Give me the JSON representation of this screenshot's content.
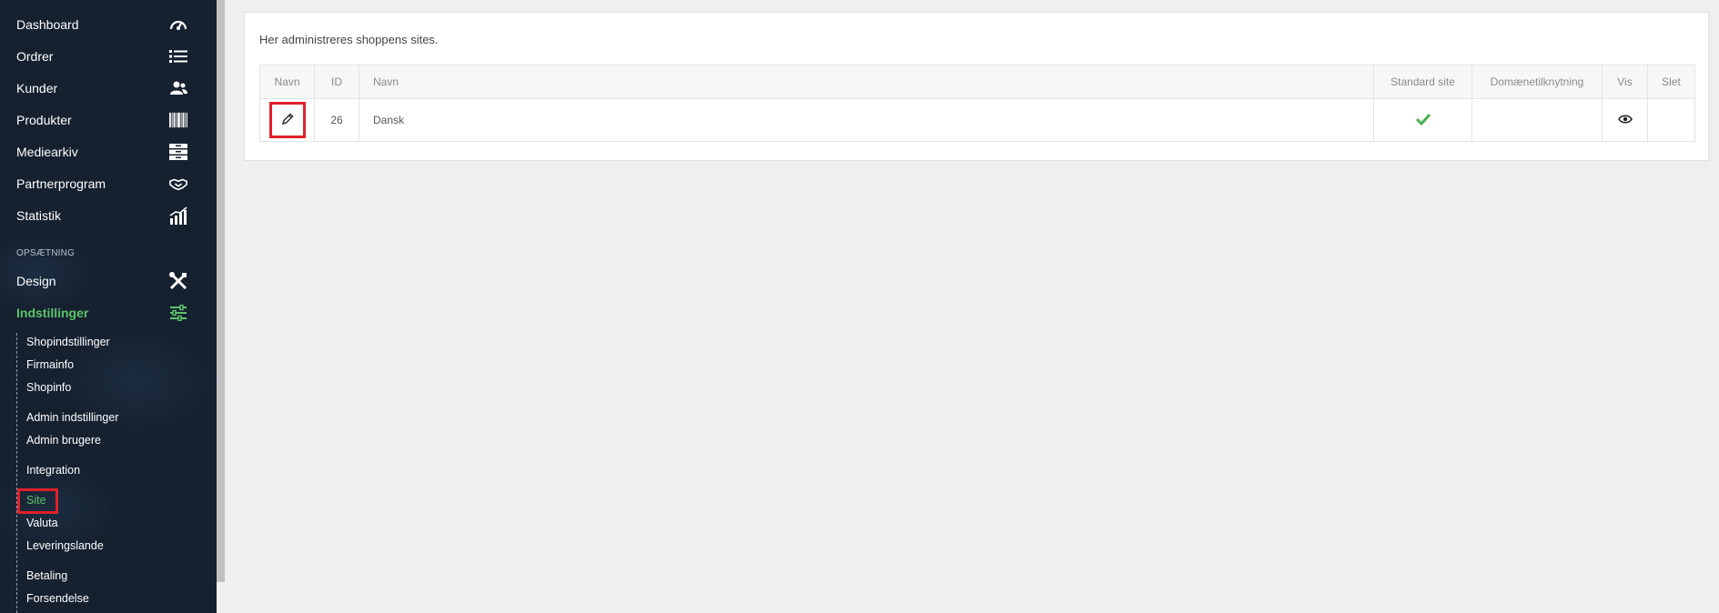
{
  "sidebar": {
    "main_items": [
      {
        "label": "Dashboard",
        "icon": "speedometer-icon"
      },
      {
        "label": "Ordrer",
        "icon": "list-icon"
      },
      {
        "label": "Kunder",
        "icon": "users-icon"
      },
      {
        "label": "Produkter",
        "icon": "barcode-icon"
      },
      {
        "label": "Mediearkiv",
        "icon": "archive-icon"
      },
      {
        "label": "Partnerprogram",
        "icon": "handshake-icon"
      },
      {
        "label": "Statistik",
        "icon": "chart-icon"
      }
    ],
    "section_label": "OPSÆTNING",
    "setup_items": [
      {
        "label": "Design",
        "icon": "tools-icon"
      },
      {
        "label": "Indstillinger",
        "icon": "sliders-icon",
        "active": true
      }
    ],
    "sub_items": [
      "Shopindstillinger",
      "Firmainfo",
      "Shopinfo",
      "Admin indstillinger",
      "Admin brugere",
      "Integration",
      "Site",
      "Valuta",
      "Leveringslande",
      "Betaling",
      "Forsendelse"
    ],
    "active_sub_item": "Site",
    "active_color": "#5cc36a"
  },
  "main": {
    "description": "Her administreres shoppens sites.",
    "table": {
      "headers": [
        "Navn",
        "ID",
        "Navn",
        "Standard site",
        "Domænetilknytning",
        "Vis",
        "Slet"
      ],
      "rows": [
        {
          "id": "26",
          "name": "Dansk",
          "standard": true,
          "domain": "",
          "vis_icon": "eye-icon"
        }
      ]
    }
  },
  "colors": {
    "highlight": "#e0202a",
    "check": "#4caf50"
  }
}
